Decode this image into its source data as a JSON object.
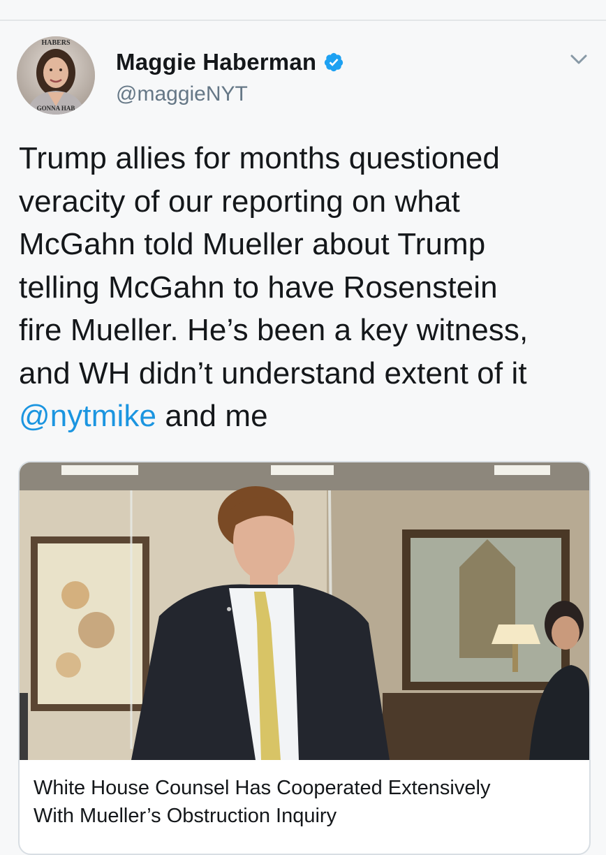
{
  "tweet": {
    "author": {
      "display_name": "Maggie Haberman",
      "handle": "@maggieNYT",
      "verified": true,
      "avatar_caption_top": "HABERS",
      "avatar_caption_bottom": "GONNA HAB"
    },
    "text_lines": [
      "Trump allies for months questioned",
      "veracity of our reporting on what",
      "McGahn told Mueller about Trump",
      "telling McGahn to have Rosenstein",
      "fire Mueller. He’s been a key witness,",
      "and WH didn’t understand extent of it"
    ],
    "mention": "@nytmike",
    "text_tail": " and me",
    "card": {
      "title_line1": "White House Counsel Has Cooperated Extensively",
      "title_line2": "With Mueller’s Obstruction Inquiry"
    },
    "more_menu_icon": "chevron-down-icon"
  },
  "colors": {
    "link": "#1b95e0",
    "verified_badge": "#1da1f2",
    "secondary_text": "#657786",
    "border": "#d8dee3",
    "background": "#f7f8f9"
  }
}
